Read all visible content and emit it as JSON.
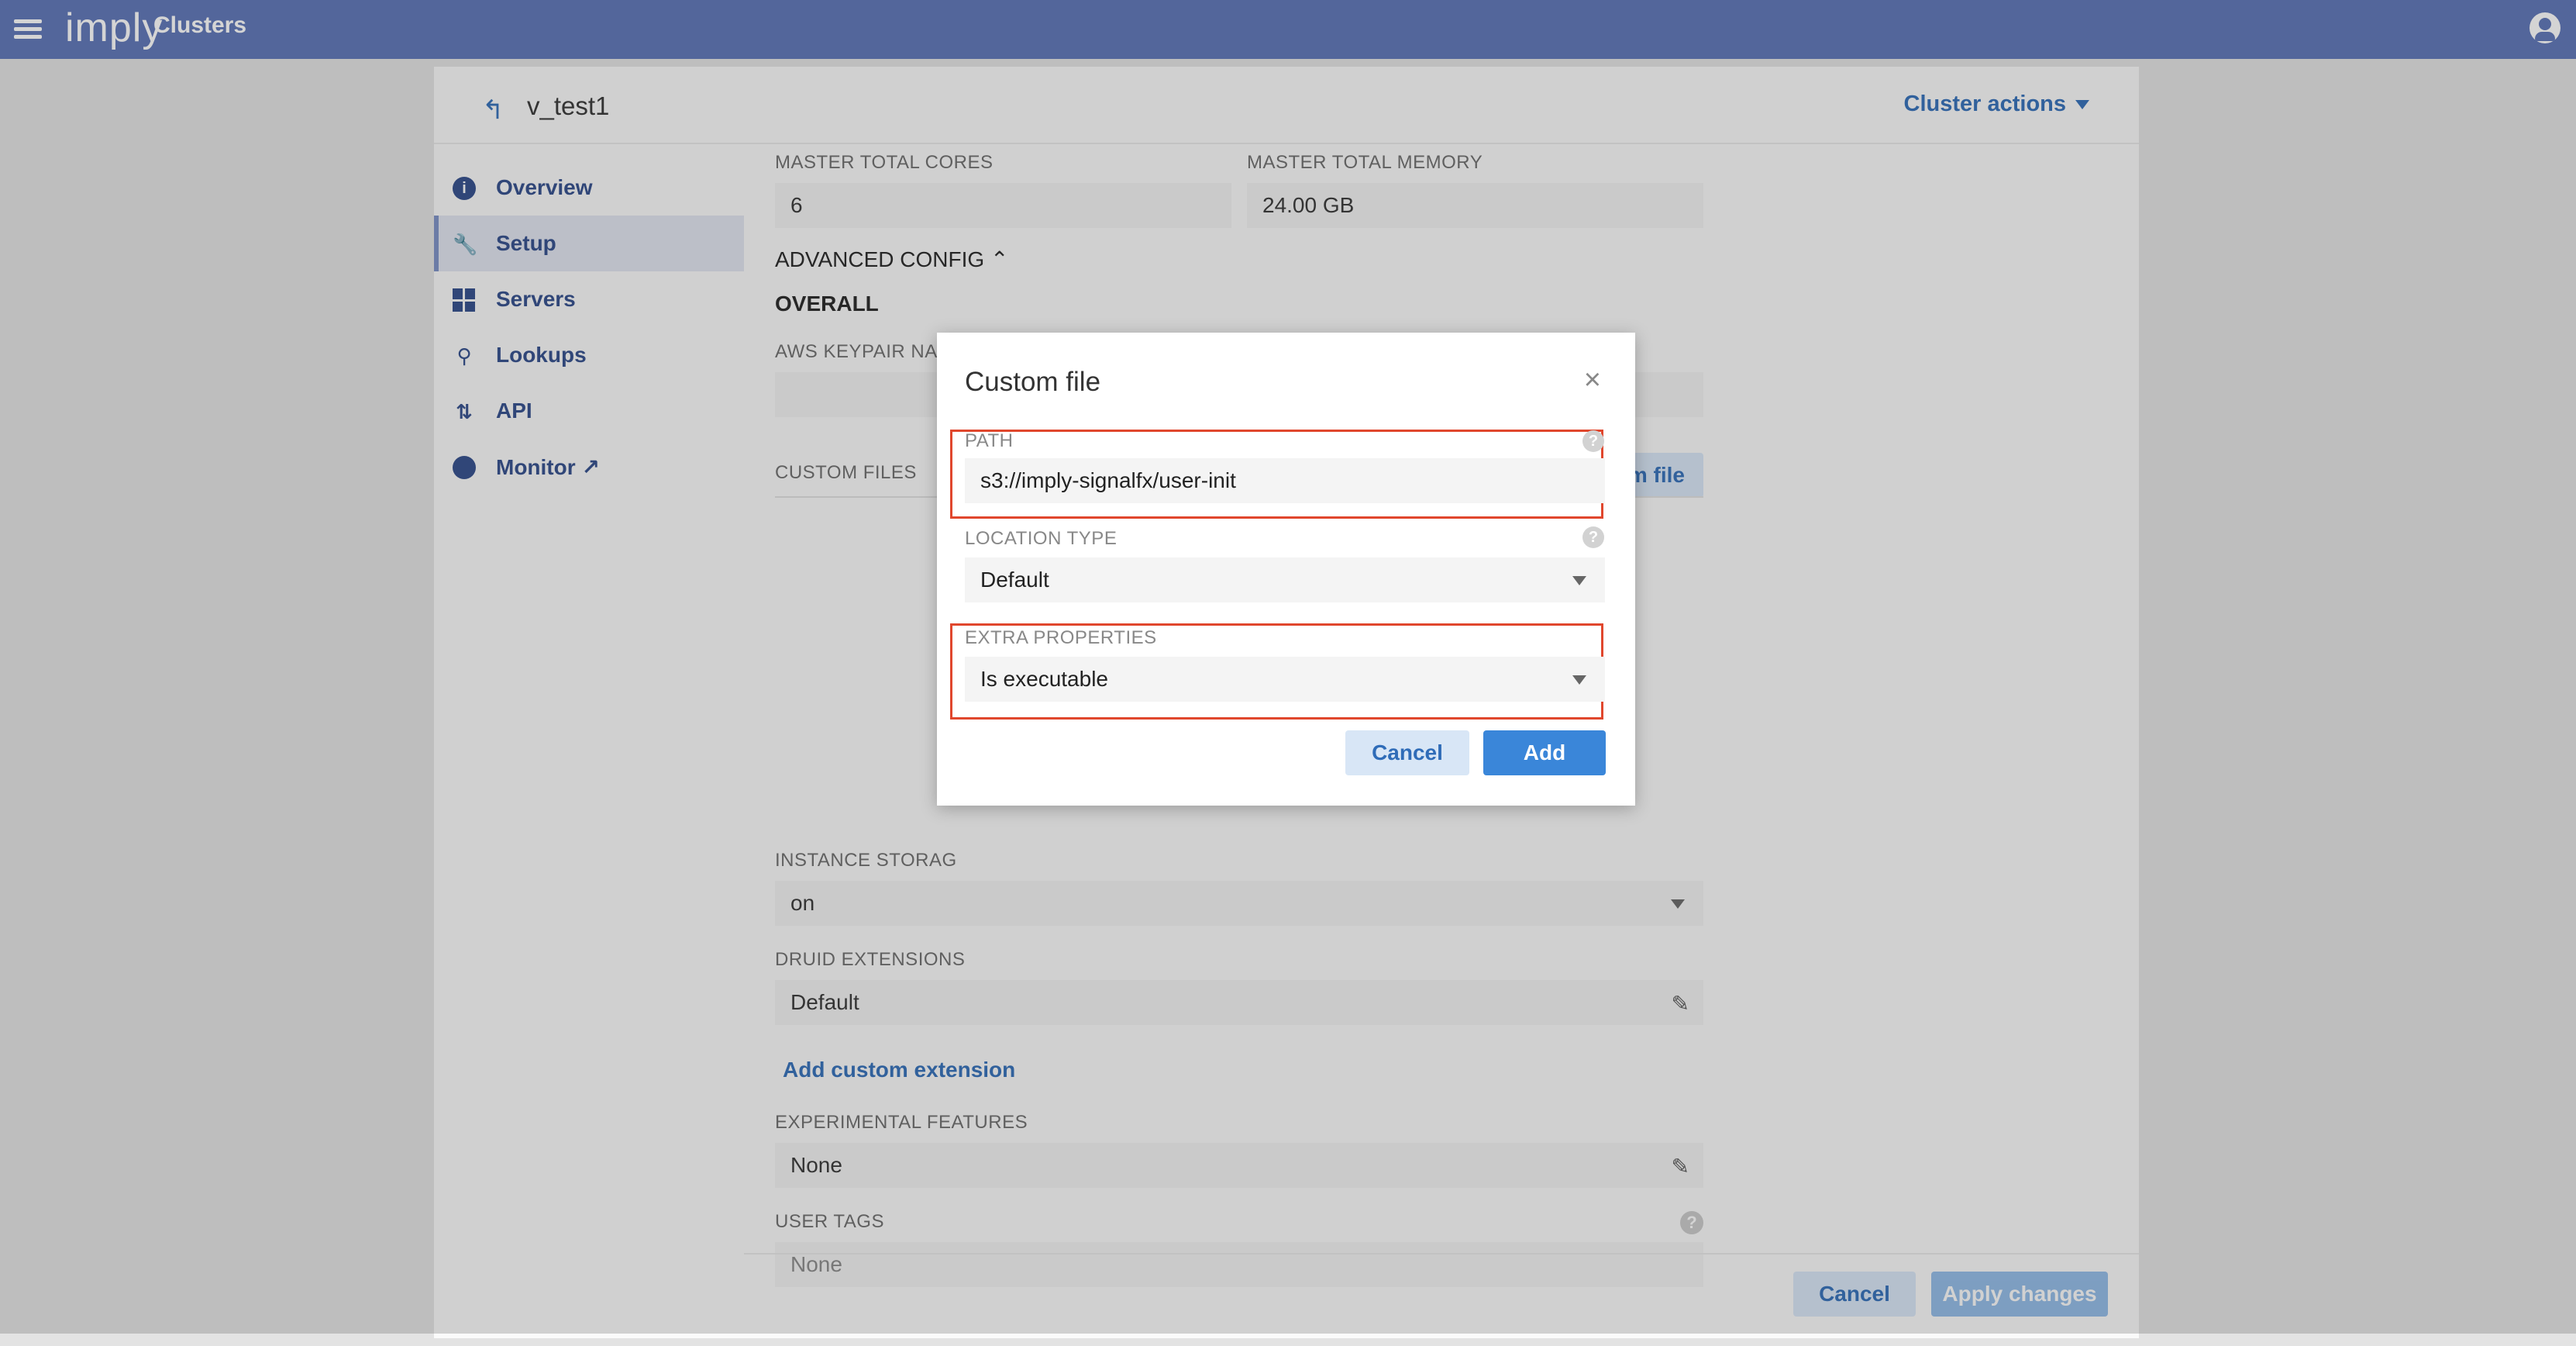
{
  "topbar": {
    "brand": "imply",
    "section": "Clusters"
  },
  "header": {
    "cluster_name": "v_test1",
    "cluster_actions": "Cluster actions"
  },
  "sidebar": {
    "items": [
      {
        "label": "Overview",
        "icon": "info-icon"
      },
      {
        "label": "Setup",
        "icon": "wrench-icon"
      },
      {
        "label": "Servers",
        "icon": "grid-icon"
      },
      {
        "label": "Lookups",
        "icon": "lookup-icon"
      },
      {
        "label": "API",
        "icon": "arrows-updown-icon"
      },
      {
        "label": "Monitor ↗",
        "icon": "monitor-icon"
      }
    ]
  },
  "form": {
    "master_total_cores_label": "MASTER TOTAL CORES",
    "master_total_cores_value": "6",
    "master_total_memory_label": "MASTER TOTAL MEMORY",
    "master_total_memory_value": "24.00 GB",
    "advanced_config_label": "ADVANCED CONFIG",
    "overall_label": "OVERALL",
    "aws_keypair_label": "AWS KEYPAIR NAM",
    "custom_files_label": "CUSTOM FILES",
    "add_custom_file_partial": "m file",
    "instance_storage_label": "INSTANCE STORAG",
    "instance_storage_value": "on",
    "druid_extensions_label": "DRUID EXTENSIONS",
    "druid_extensions_value": "Default",
    "add_custom_extension": "Add custom extension",
    "experimental_features_label": "EXPERIMENTAL FEATURES",
    "experimental_features_value": "None",
    "user_tags_label": "USER TAGS",
    "user_tags_value": "None"
  },
  "footer": {
    "cancel": "Cancel",
    "apply": "Apply changes"
  },
  "modal": {
    "title": "Custom file",
    "path_label": "PATH",
    "path_value": "s3://imply-signalfx/user-init",
    "location_type_label": "LOCATION TYPE",
    "location_type_value": "Default",
    "extra_properties_label": "EXTRA PROPERTIES",
    "extra_properties_value": "Is executable",
    "cancel": "Cancel",
    "add": "Add"
  },
  "colors": {
    "topbar": "#5a73b6",
    "accent": "#2f6cb8",
    "primary_button": "#3a86d9",
    "highlight": "#e0472d"
  }
}
